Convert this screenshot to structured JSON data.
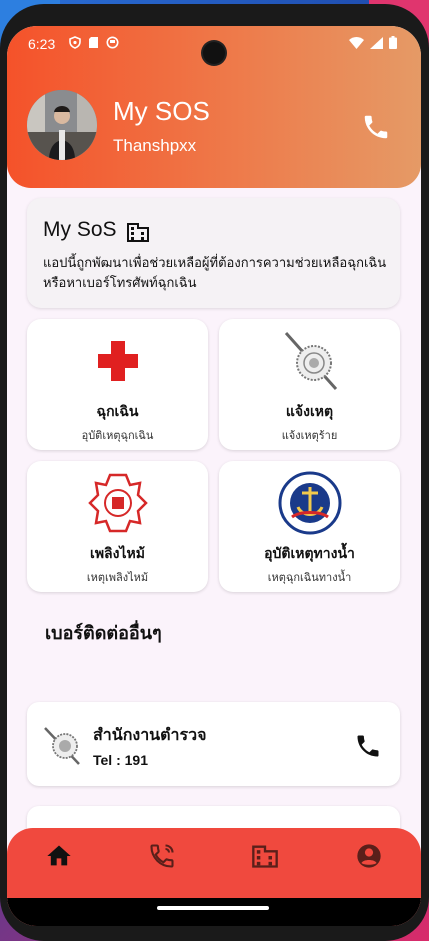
{
  "status_bar": {
    "time": "6:23"
  },
  "header": {
    "app_title": "My SOS",
    "user_name": "Thanshpxx"
  },
  "info": {
    "title": "My SoS",
    "description": "แอปนี้ถูกพัฒนาเพื่อช่วยเหลือผู้ที่ต้องการความช่วยเหลือฉุกเฉิน หรือหาเบอร์โทรศัพท์ฉุกเฉิน"
  },
  "tiles": [
    {
      "title": "ฉุกเฉิน",
      "subtitle": "อุบัติเหตุฉุกเฉิน",
      "icon": "red-cross-icon"
    },
    {
      "title": "แจ้งเหตุ",
      "subtitle": "แจ้งเหตุร้าย",
      "icon": "police-badge-icon"
    },
    {
      "title": "เพลิงไหม้",
      "subtitle": "เหตุเพลิงไหม้",
      "icon": "fire-department-icon"
    },
    {
      "title": "อุบัติเหตุทางน้ำ",
      "subtitle": "เหตุฉุกเฉินทางน้ำ",
      "icon": "marine-rescue-icon"
    }
  ],
  "section": {
    "title": "เบอร์ติดต่ออื่นๆ"
  },
  "contacts": [
    {
      "name": "สำนักงานตำรวจ",
      "tel": "Tel : 191"
    }
  ],
  "colors": {
    "header_start": "#f5522a",
    "header_end": "#e59a66",
    "nav_bg": "#f0493e",
    "accent_red": "#e02020"
  },
  "bottom_nav": [
    "home-icon",
    "phone-call-icon",
    "building-icon",
    "account-icon"
  ]
}
